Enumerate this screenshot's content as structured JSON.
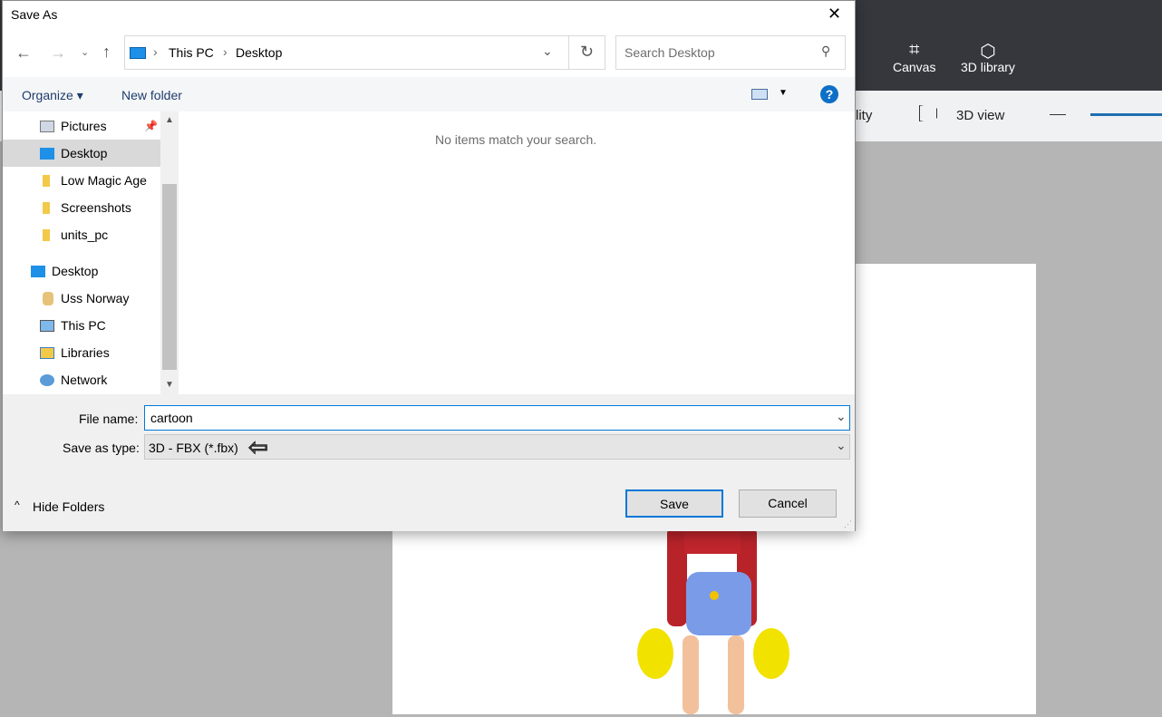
{
  "app": {
    "canvas_label": "Canvas",
    "library_label": "3D library",
    "visibility_partial": "lity",
    "view_label": "3D view"
  },
  "dialog": {
    "title": "Save As",
    "close": "✕",
    "breadcrumb": [
      "This PC",
      "Desktop"
    ],
    "search_placeholder": "Search Desktop",
    "organize": "Organize ▾",
    "new_folder": "New folder",
    "help": "?",
    "empty_message": "No items match your search.",
    "nav": [
      {
        "label": "Pictures",
        "icon": "pictures-icon"
      },
      {
        "label": "Desktop",
        "icon": "desktop-icon",
        "selected": true
      },
      {
        "label": "Low Magic Age",
        "icon": "folder-icon"
      },
      {
        "label": "Screenshots",
        "icon": "folder-icon"
      },
      {
        "label": "units_pc",
        "icon": "folder-icon"
      },
      {
        "label": "Desktop",
        "icon": "desktop-icon"
      },
      {
        "label": "Uss Norway",
        "icon": "user-icon"
      },
      {
        "label": "This PC",
        "icon": "pc-icon"
      },
      {
        "label": "Libraries",
        "icon": "libraries-icon"
      },
      {
        "label": "Network",
        "icon": "network-icon"
      }
    ],
    "file_name_label": "File name:",
    "file_name_value": "cartoon",
    "save_type_label": "Save as type:",
    "save_type_value": "3D - FBX (*.fbx)",
    "hide_folders": "Hide Folders",
    "save": "Save",
    "cancel": "Cancel"
  }
}
